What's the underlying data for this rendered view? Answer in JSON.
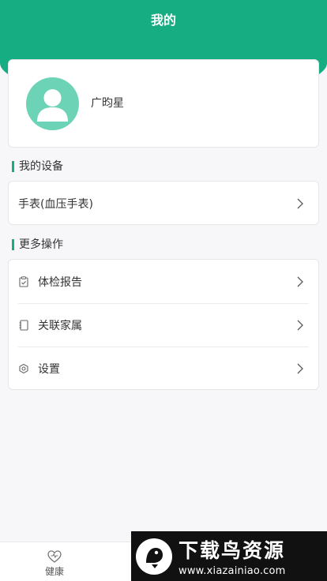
{
  "header": {
    "title": "我的"
  },
  "profile": {
    "name": "广昀星",
    "avatar": "avatar-placeholder-icon"
  },
  "devices": {
    "title": "我的设备",
    "items": [
      {
        "label": "手表(血压手表)"
      }
    ]
  },
  "more": {
    "title": "更多操作",
    "items": [
      {
        "label": "体检报告",
        "icon": "clipboard-icon"
      },
      {
        "label": "关联家属",
        "icon": "contact-book-icon"
      },
      {
        "label": "设置",
        "icon": "settings-icon"
      }
    ]
  },
  "tabbar": {
    "health_label": "健康"
  },
  "watermark": {
    "title": "下载鸟资源",
    "url": "www.xiazainiao.com"
  },
  "colors": {
    "accent": "#17ad83",
    "avatar_bg": "#6dd3b6",
    "background": "#f7f6f9"
  }
}
